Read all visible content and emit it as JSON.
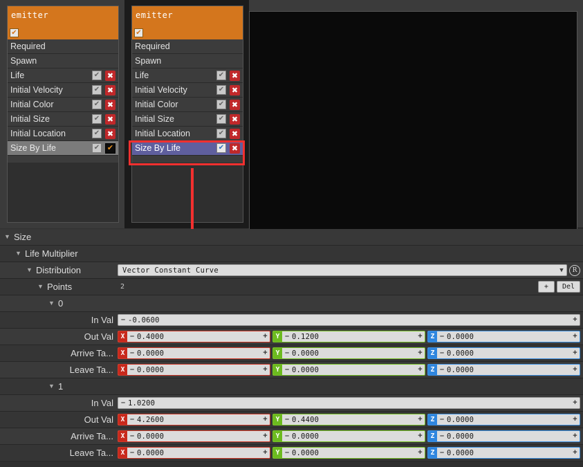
{
  "emitters": [
    {
      "name": "emitter",
      "enabled_icon": "check-icon",
      "selected_module": "Size By Life",
      "selection_style": "gray",
      "modules": [
        {
          "label": "Required",
          "type": "plain"
        },
        {
          "label": "Spawn",
          "type": "plain"
        },
        {
          "label": "Life",
          "type": "toggle",
          "checkbox": "check-icon",
          "action": "x-icon"
        },
        {
          "label": "Initial Velocity",
          "type": "toggle",
          "checkbox": "check-icon",
          "action": "x-icon"
        },
        {
          "label": "Initial Color",
          "type": "toggle",
          "checkbox": "check-icon",
          "action": "x-icon"
        },
        {
          "label": "Initial Size",
          "type": "toggle",
          "checkbox": "check-icon",
          "action": "x-icon"
        },
        {
          "label": "Initial Location",
          "type": "toggle",
          "checkbox": "check-icon",
          "action": "x-icon"
        },
        {
          "label": "Size By Life",
          "type": "selected-gray",
          "checkbox": "check-icon",
          "action": "check-box-orange-icon"
        }
      ]
    },
    {
      "name": "emitter",
      "enabled_icon": "check-icon",
      "selected_module": "Size By Life",
      "selection_style": "purple",
      "modules": [
        {
          "label": "Required",
          "type": "plain"
        },
        {
          "label": "Spawn",
          "type": "plain"
        },
        {
          "label": "Life",
          "type": "toggle",
          "checkbox": "check-icon",
          "action": "x-icon"
        },
        {
          "label": "Initial Velocity",
          "type": "toggle",
          "checkbox": "check-icon",
          "action": "x-icon"
        },
        {
          "label": "Initial Color",
          "type": "toggle",
          "checkbox": "check-icon",
          "action": "x-icon"
        },
        {
          "label": "Initial Size",
          "type": "toggle",
          "checkbox": "check-icon",
          "action": "x-icon"
        },
        {
          "label": "Initial Location",
          "type": "toggle",
          "checkbox": "check-icon",
          "action": "x-icon"
        },
        {
          "label": "Size By Life",
          "type": "selected-purple",
          "checkbox": "check-icon-blue",
          "action": "x-icon"
        }
      ]
    }
  ],
  "annotations": {
    "highlight_rect_color": "#f2302f",
    "arrow_color": "#f2302f",
    "arrow_direction": "down"
  },
  "colors": {
    "emitter_header": "#d4761d",
    "selection_purple": "#5f5f9e",
    "selection_gray": "#7b7b7b",
    "axis_x": "#c8291c",
    "axis_y": "#6cba1f",
    "axis_z": "#2f86df",
    "delete_red": "#c0282a"
  },
  "details": {
    "size": {
      "label": "Size",
      "tri": "▼"
    },
    "life_multiplier": {
      "label": "Life Multiplier",
      "tri": "▼"
    },
    "distribution": {
      "label": "Distribution",
      "tri": "▼",
      "value": "Vector Constant Curve",
      "chevron_icon": "chevron-down-icon",
      "reset_icon": "reset-to-default-icon",
      "reset_label": "R"
    },
    "points": {
      "label": "Points",
      "tri": "▼",
      "count": "2",
      "add_label": "+",
      "delete_label": "Del"
    },
    "point_rows": [
      {
        "index": "0",
        "tri": "▼",
        "in_val": {
          "label": "In Val",
          "minus": "–",
          "value": "-0.0600",
          "plus": "+"
        },
        "out_val": {
          "label": "Out Val",
          "x": {
            "tab": "X",
            "minus": "–",
            "value": "0.4000",
            "plus": "+"
          },
          "y": {
            "tab": "Y",
            "minus": "–",
            "value": "0.1200",
            "plus": "+"
          },
          "z": {
            "tab": "Z",
            "minus": "–",
            "value": "0.0000",
            "plus": "+"
          }
        },
        "arrive_tangent": {
          "label": "Arrive Ta...",
          "x": {
            "tab": "X",
            "minus": "–",
            "value": "0.0000",
            "plus": "+"
          },
          "y": {
            "tab": "Y",
            "minus": "–",
            "value": "0.0000",
            "plus": "+"
          },
          "z": {
            "tab": "Z",
            "minus": "–",
            "value": "0.0000",
            "plus": "+"
          }
        },
        "leave_tangent": {
          "label": "Leave Ta...",
          "x": {
            "tab": "X",
            "minus": "–",
            "value": "0.0000",
            "plus": "+"
          },
          "y": {
            "tab": "Y",
            "minus": "–",
            "value": "0.0000",
            "plus": "+"
          },
          "z": {
            "tab": "Z",
            "minus": "–",
            "value": "0.0000",
            "plus": "+"
          }
        }
      },
      {
        "index": "1",
        "tri": "▼",
        "in_val": {
          "label": "In Val",
          "minus": "–",
          "value": "1.0200",
          "plus": "+"
        },
        "out_val": {
          "label": "Out Val",
          "x": {
            "tab": "X",
            "minus": "–",
            "value": "4.2600",
            "plus": "+"
          },
          "y": {
            "tab": "Y",
            "minus": "–",
            "value": "0.4400",
            "plus": "+"
          },
          "z": {
            "tab": "Z",
            "minus": "–",
            "value": "0.0000",
            "plus": "+"
          }
        },
        "arrive_tangent": {
          "label": "Arrive Ta...",
          "x": {
            "tab": "X",
            "minus": "–",
            "value": "0.0000",
            "plus": "+"
          },
          "y": {
            "tab": "Y",
            "minus": "–",
            "value": "0.0000",
            "plus": "+"
          },
          "z": {
            "tab": "Z",
            "minus": "–",
            "value": "0.0000",
            "plus": "+"
          }
        },
        "leave_tangent": {
          "label": "Leave Ta...",
          "x": {
            "tab": "X",
            "minus": "–",
            "value": "0.0000",
            "plus": "+"
          },
          "y": {
            "tab": "Y",
            "minus": "–",
            "value": "0.0000",
            "plus": "+"
          },
          "z": {
            "tab": "Z",
            "minus": "–",
            "value": "0.0000",
            "plus": "+"
          }
        }
      }
    ]
  }
}
